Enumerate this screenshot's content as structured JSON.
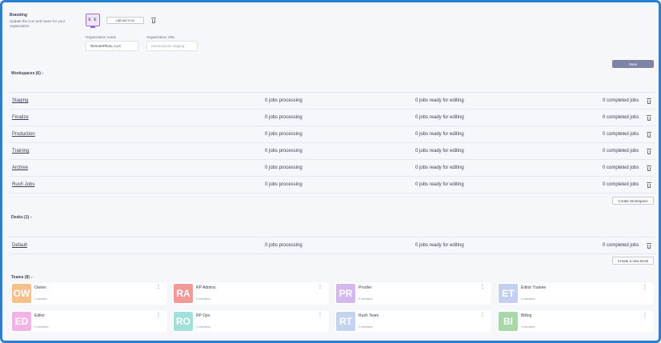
{
  "branding": {
    "title": "Branding",
    "description": "Update the icon and name for your organization",
    "logo_initials": "E E",
    "upload_label": "Upload Icon"
  },
  "org": {
    "name_label": "Organization name",
    "name_value": "RemotePhoto, LLC",
    "url_label": "Organization URL",
    "url_placeholder": "remotephoto-staging"
  },
  "save_label": "Save",
  "workspaces": {
    "title": "Workspaces (6)",
    "chevron": "˅",
    "rows": [
      {
        "name": "Staging",
        "processing": "0 jobs processing",
        "ready": "0 jobs ready for editing",
        "completed": "0 completed jobs"
      },
      {
        "name": "Finalize",
        "processing": "0 jobs processing",
        "ready": "0 jobs ready for editing",
        "completed": "0 completed jobs"
      },
      {
        "name": "Production",
        "processing": "0 jobs processing",
        "ready": "0 jobs ready for editing",
        "completed": "0 completed jobs"
      },
      {
        "name": "Training",
        "processing": "0 jobs processing",
        "ready": "0 jobs ready for editing",
        "completed": "0 completed jobs"
      },
      {
        "name": "Archive",
        "processing": "0 jobs processing",
        "ready": "0 jobs ready for editing",
        "completed": "0 completed jobs"
      },
      {
        "name": "Rush Jobs",
        "processing": "0 jobs processing",
        "ready": "0 jobs ready for editing",
        "completed": "0 completed jobs"
      }
    ],
    "create_label": "Create Workspace"
  },
  "desks": {
    "title": "Desks (1)",
    "chevron": "˅",
    "rows": [
      {
        "name": "Default",
        "processing": "0 jobs processing",
        "ready": "0 jobs ready for editing",
        "completed": "0 completed jobs"
      }
    ],
    "create_label": "Create a new Desk"
  },
  "teams": {
    "title": "Teams (8)",
    "chevron": "˅",
    "cards": [
      {
        "initials": "OW",
        "name": "Owner",
        "sub": "1 member",
        "color": "#f6c08a"
      },
      {
        "initials": "RA",
        "name": "RP Admins",
        "sub": "0 members",
        "color": "#f29a9a"
      },
      {
        "initials": "PR",
        "name": "Proofer",
        "sub": "0 members",
        "color": "#d5b8ee"
      },
      {
        "initials": "ET",
        "name": "Editor Trainee",
        "sub": "0 members",
        "color": "#c3d0f2"
      },
      {
        "initials": "ED",
        "name": "Editor",
        "sub": "0 members",
        "color": "#f4b3e6"
      },
      {
        "initials": "RO",
        "name": "RP Ops",
        "sub": "0 members",
        "color": "#a3dfdb"
      },
      {
        "initials": "RT",
        "name": "Rush Team",
        "sub": "0 members",
        "color": "#c4d3f0"
      },
      {
        "initials": "BI",
        "name": "Billing",
        "sub": "0 members",
        "color": "#a8d8a8"
      }
    ]
  }
}
